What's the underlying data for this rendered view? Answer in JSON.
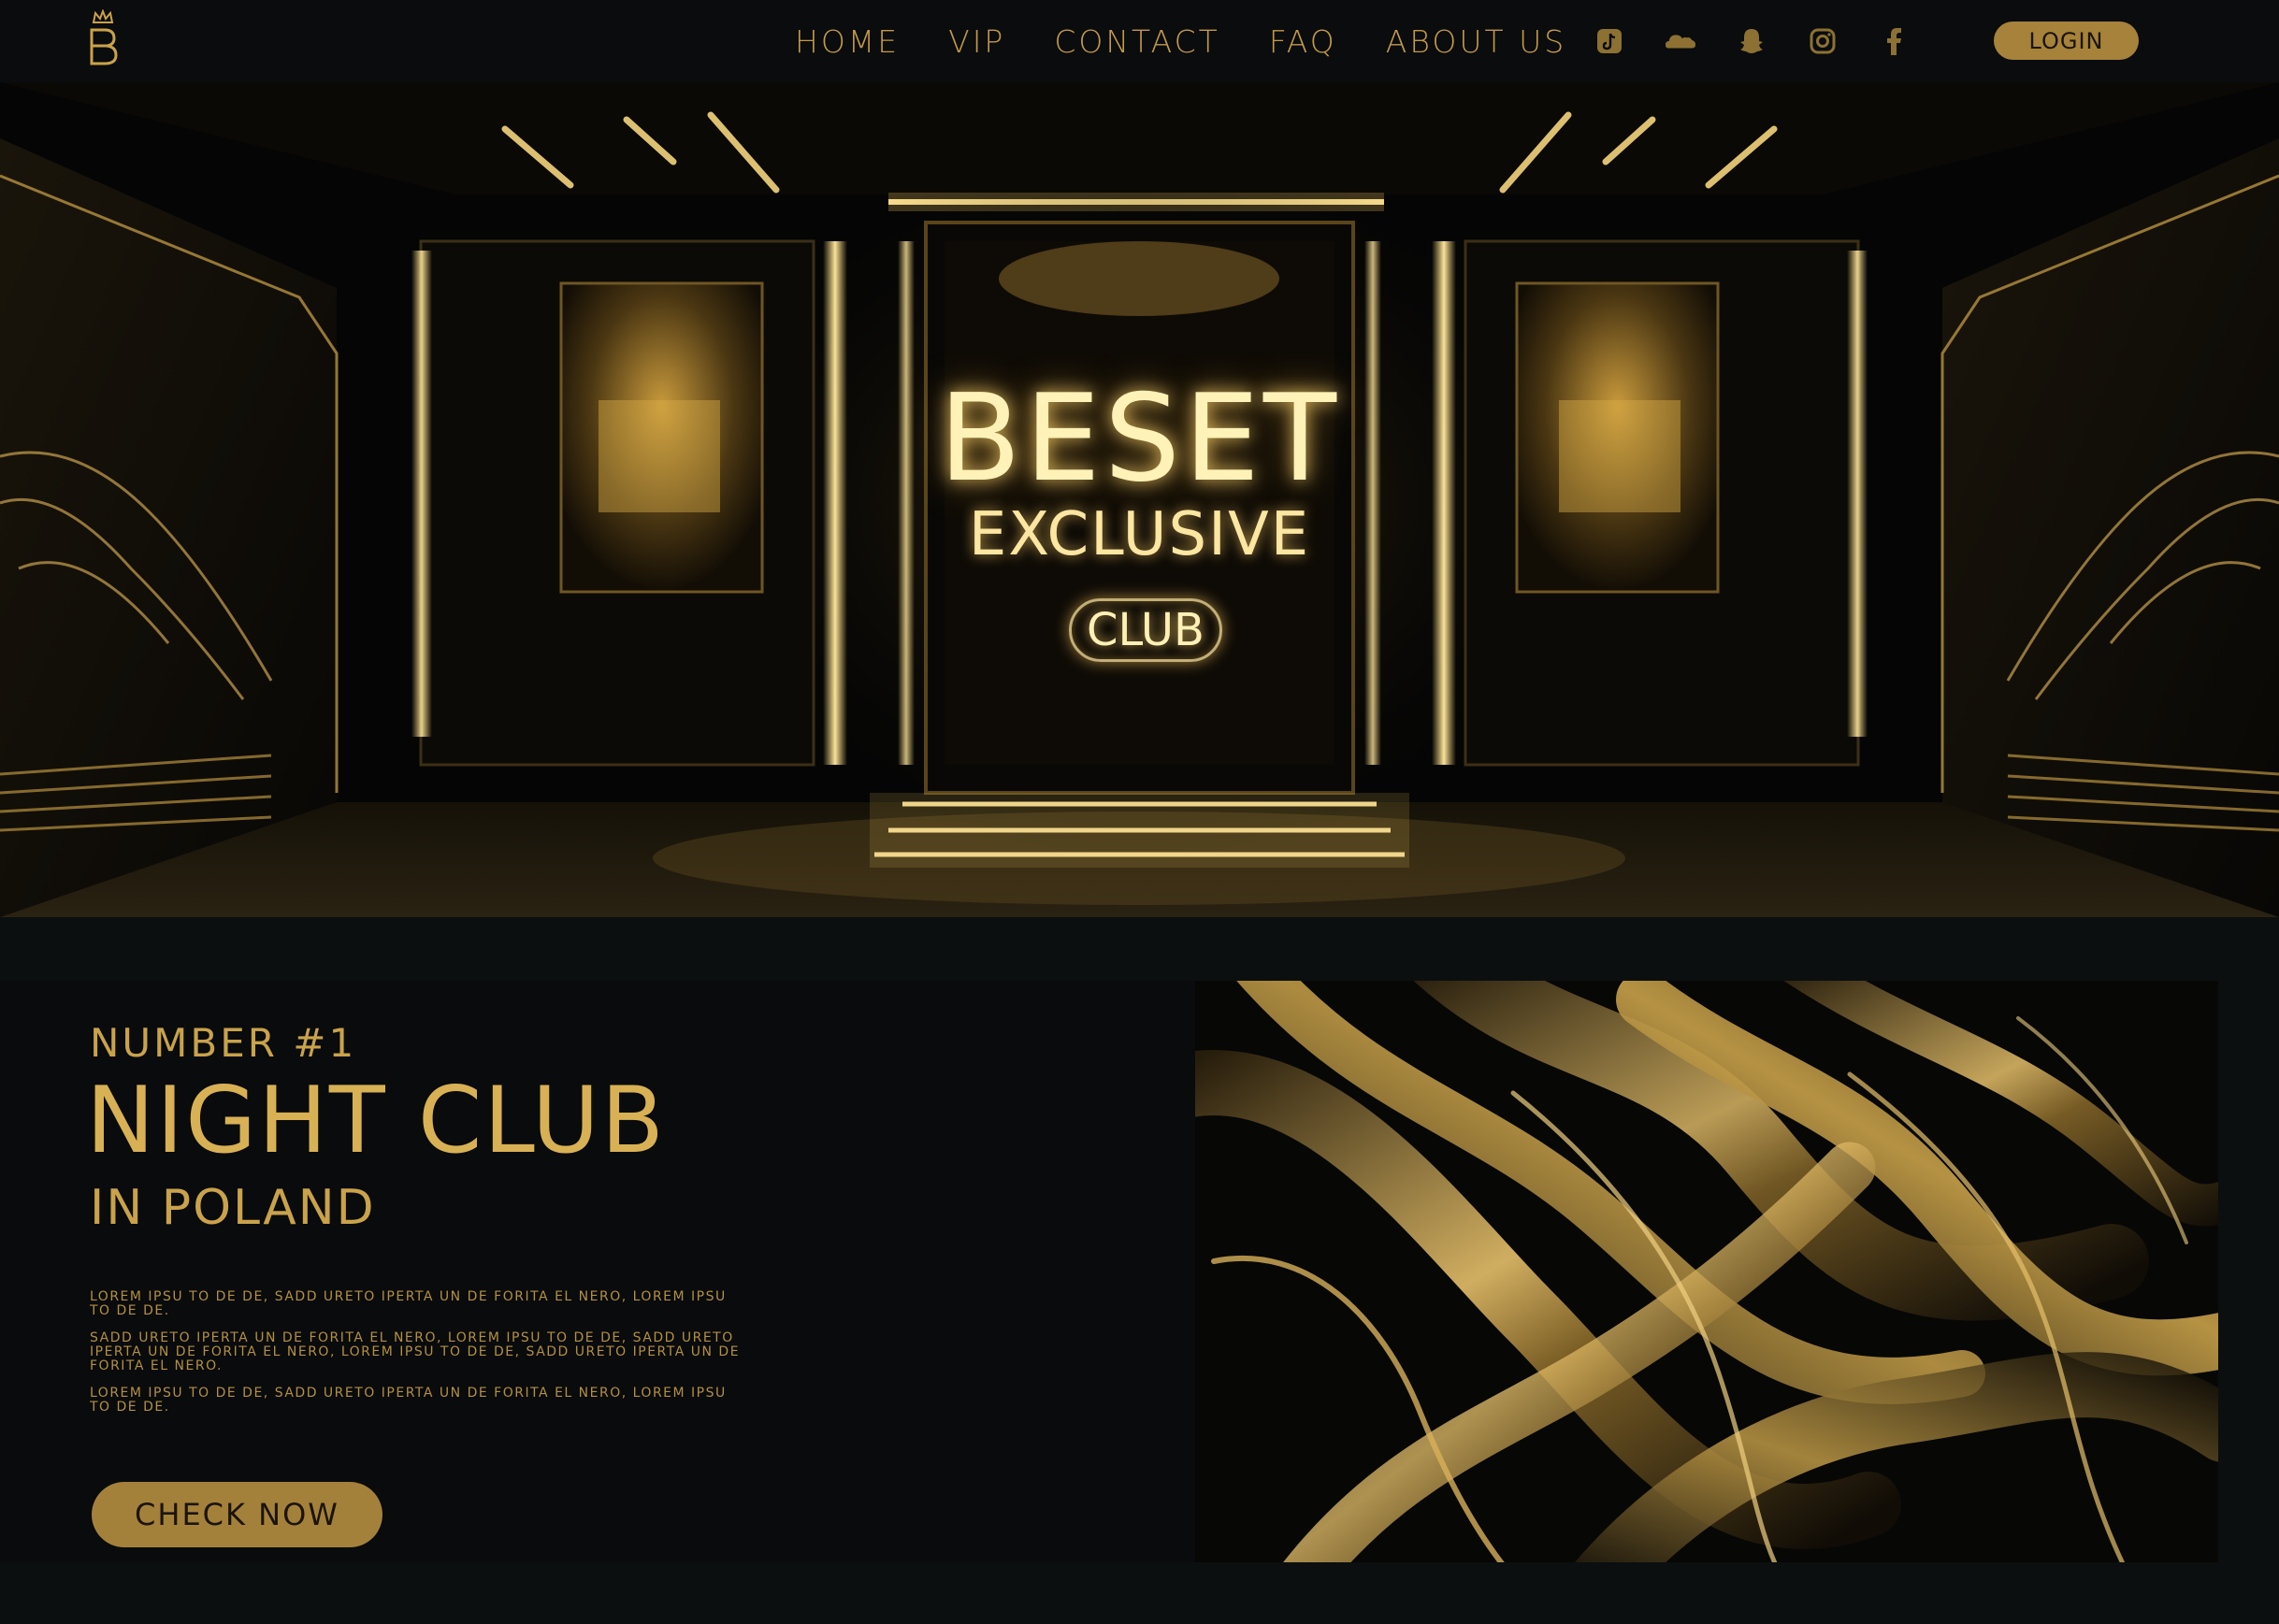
{
  "nav": {
    "links": [
      "HOME",
      "VIP",
      "CONTACT",
      "FAQ",
      "ABOUT US"
    ],
    "socials": [
      {
        "icon": "tiktok-icon"
      },
      {
        "icon": "soundcloud-icon"
      },
      {
        "icon": "snapchat-icon"
      },
      {
        "icon": "instagram-icon"
      },
      {
        "icon": "facebook-icon"
      }
    ],
    "login_label": "LOGIN"
  },
  "logo": {
    "icon": "crown-b-logo"
  },
  "hero": {
    "title": "BESET",
    "subtitle": "EXCLUSIVE",
    "badge": "CLUB"
  },
  "promo": {
    "eyebrow": "NUMBER #1",
    "headline": "NIGHT CLUB",
    "subheadline": "IN POLAND",
    "paragraphs": [
      "LOREM IPSU TO DE DE, SADD URETO IPERTA UN DE FORITA EL NERO, LOREM IPSU TO DE DE.",
      "SADD URETO IPERTA UN DE FORITA EL NERO, LOREM IPSU TO DE DE, SADD URETO IPERTA UN DE FORITA EL NERO, LOREM IPSU TO DE DE, SADD URETO IPERTA UN DE FORITA EL NERO.",
      "LOREM IPSU TO DE DE, SADD URETO IPERTA UN DE FORITA EL NERO, LOREM IPSU TO DE DE."
    ],
    "cta_label": "CHECK NOW"
  },
  "colors": {
    "gold": "#c9a24a",
    "button_gold": "#a6823a",
    "background": "#0c0f10",
    "glow": "#fff2b8"
  }
}
